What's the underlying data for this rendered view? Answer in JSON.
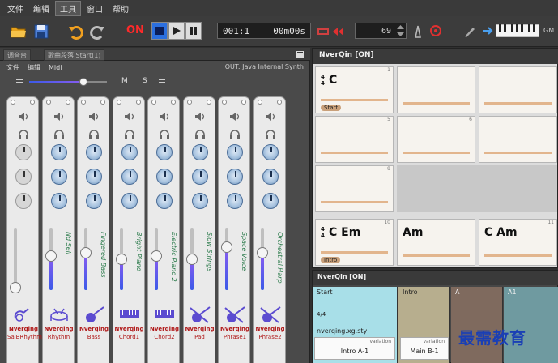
{
  "menu": [
    "文件",
    "编辑",
    "工具",
    "窗口",
    "帮助"
  ],
  "menu_active": "工具",
  "toolbar": {
    "on_label": "ON",
    "position": "001:1",
    "time": "00m00s",
    "tempo": "69",
    "gm_label": "GM"
  },
  "left_panel": {
    "tabs": [
      "调音台",
      "歌曲段落 Start(1)"
    ],
    "submenu": [
      "文件",
      "编辑",
      "Midi"
    ],
    "output": "OUT: Java Internal Synth",
    "master_buttons": [
      "M",
      "S"
    ],
    "master_volume": 0.7
  },
  "channels": [
    {
      "name": "Nverqing",
      "sub": "SalBRhythm",
      "instrument": "",
      "volume": 0.0,
      "active": false
    },
    {
      "name": "Nverqing",
      "sub": "Rhythm",
      "instrument": "Nd Sell",
      "volume": 0.55,
      "active": true
    },
    {
      "name": "Nverqing",
      "sub": "Bass",
      "instrument": "Fingered Bass",
      "volume": 0.6,
      "active": true
    },
    {
      "name": "Nverqing",
      "sub": "Chord1",
      "instrument": "Bright Piano",
      "volume": 0.5,
      "active": true
    },
    {
      "name": "Nverqing",
      "sub": "Chord2",
      "instrument": "Electric Piano 2",
      "volume": 0.55,
      "active": true
    },
    {
      "name": "Nverqing",
      "sub": "Pad",
      "instrument": "Slow Strings",
      "volume": 0.5,
      "active": true
    },
    {
      "name": "Nverqing",
      "sub": "Phrase1",
      "instrument": "Space Voice",
      "volume": 0.7,
      "active": true
    },
    {
      "name": "Nverqing",
      "sub": "Phrase2",
      "instrument": "Orchestral Harp",
      "volume": 0.6,
      "active": true
    }
  ],
  "chord_panel": {
    "title": "NverQin [ON]",
    "time_signature": [
      "4",
      "4"
    ],
    "cells": [
      {
        "num": "1",
        "chord": "C",
        "marker": "Start",
        "ts": true
      },
      {
        "num": "",
        "chord": "",
        "marker": ""
      },
      {
        "num": "",
        "chord": "",
        "marker": ""
      },
      {
        "num": "5",
        "chord": "",
        "marker": ""
      },
      {
        "num": "6",
        "chord": "",
        "marker": ""
      },
      {
        "num": "",
        "chord": "",
        "marker": ""
      },
      {
        "num": "9",
        "chord": "",
        "marker": ""
      },
      {
        "num": "10",
        "chord": "C  Em",
        "marker": "Intro",
        "ts": true
      },
      {
        "num": "",
        "chord": "Am",
        "marker": ""
      },
      {
        "num": "11",
        "chord": "C   Am",
        "marker": ""
      }
    ]
  },
  "sections_panel": {
    "title": "NverQin [ON]",
    "sections": [
      {
        "label": "Start",
        "ts": "4/4",
        "style": "nverqing.xg.sty",
        "variation_label": "variation",
        "variation": "Intro A-1",
        "color": "#a8dfe8"
      },
      {
        "label": "Intro",
        "variation_label": "variation",
        "variation": "Main B-1",
        "color": "#b7ae8e"
      },
      {
        "label": "A",
        "color": "#7f6a5e"
      },
      {
        "label": "A1",
        "color": "#6f9aa0"
      }
    ]
  },
  "watermark": "最需教育"
}
